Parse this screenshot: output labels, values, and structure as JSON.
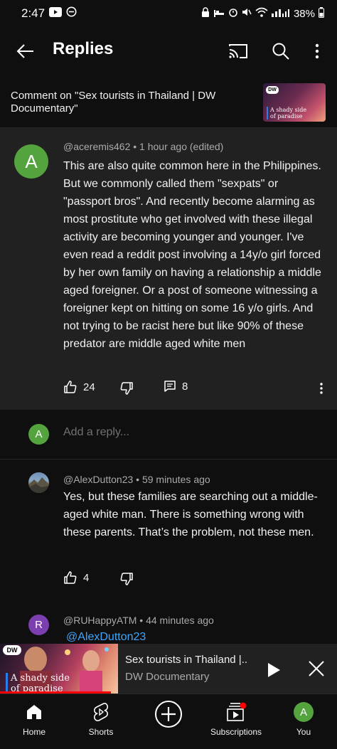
{
  "status_bar": {
    "time": "2:47",
    "battery": "38%"
  },
  "header": {
    "title": "Replies"
  },
  "video_ref": {
    "text": "Comment on \"Sex tourists in Thailand | DW Documentary\"",
    "thumb_logo": "DW",
    "thumb_caption_line1": "A shady side",
    "thumb_caption_line2": "of paradise"
  },
  "main_comment": {
    "avatar_letter": "A",
    "meta": "@aceremis462 • 1 hour ago (edited)",
    "body": "This are also quite common here in the Philippines. But we commonly called them \"sexpats\" or \"passport bros\". And recently become alarming as most prostitute who get involved with these illegal activity are becoming younger and younger. I've even read a reddit post involving a 14y/o girl forced by her own family on having a relationship a middle aged foreigner. Or a post of someone witnessing a foreigner kept on hitting on some 16 y/o girls. And not trying to be racist here but like 90% of these predator are middle aged white men",
    "likes": "24",
    "replies": "8"
  },
  "reply_box": {
    "avatar_letter": "A",
    "placeholder": "Add a reply..."
  },
  "replies": [
    {
      "meta": "@AlexDutton23 • 59 minutes ago",
      "body": "Yes, but these families are searching out a middle-aged white man. There is something wrong with these parents. That’s the problem, not these men.",
      "likes": "4"
    },
    {
      "avatar_letter": "R",
      "meta": "@RUHappyATM • 44 minutes ago",
      "mention": "@AlexDutton23"
    }
  ],
  "mini_player": {
    "title": "Sex tourists in Thailand |..",
    "channel": "DW Documentary",
    "thumb_logo": "DW",
    "caption_line1": "A shady side",
    "caption_line2": "of paradise",
    "progress": 0.33
  },
  "bottom_nav": {
    "home": "Home",
    "shorts": "Shorts",
    "subscriptions": "Subscriptions",
    "you": "You",
    "you_avatar_letter": "A"
  },
  "colors": {
    "background": "#0f0f0f",
    "card": "#212121",
    "avatar_green": "#54a33f",
    "avatar_purple": "#7b3fb0",
    "mention_blue": "#3ea6ff",
    "accent_red": "#ff0000"
  }
}
